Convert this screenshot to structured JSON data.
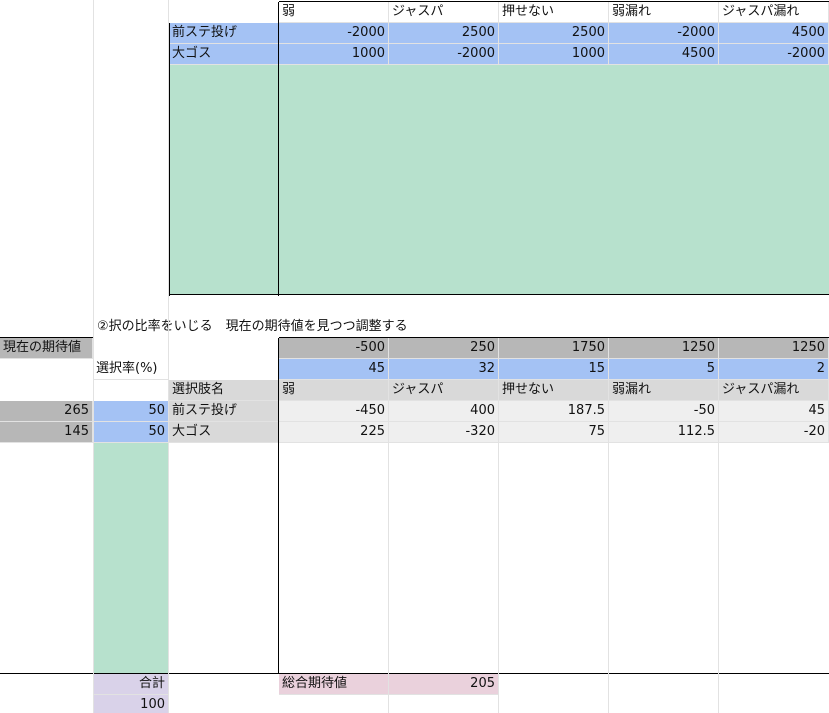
{
  "top_table": {
    "headers": [
      "弱",
      "ジャスパ",
      "押せない",
      "弱漏れ",
      "ジャスパ漏れ"
    ],
    "rows": [
      {
        "label": "前ステ投げ",
        "values": [
          "-2000",
          "2500",
          "2500",
          "-2000",
          "4500"
        ]
      },
      {
        "label": "大ゴス",
        "values": [
          "1000",
          "-2000",
          "1000",
          "4500",
          "-2000"
        ]
      }
    ]
  },
  "instruction": "②択の比率をいじる　現在の期待値を見つつ調整する",
  "bottom": {
    "current_ev_label": "現在の期待値",
    "column_ev": [
      "-500",
      "250",
      "1750",
      "1250",
      "1250"
    ],
    "selection_rate_label": "選択率(%)",
    "selection_rates": [
      "45",
      "32",
      "15",
      "5",
      "2"
    ],
    "option_name_label": "選択肢名",
    "headers": [
      "弱",
      "ジャスパ",
      "押せない",
      "弱漏れ",
      "ジャスパ漏れ"
    ],
    "rows": [
      {
        "ev": "265",
        "ratio": "50",
        "label": "前ステ投げ",
        "values": [
          "-450",
          "400",
          "187.5",
          "-50",
          "45"
        ]
      },
      {
        "ev": "145",
        "ratio": "50",
        "label": "大ゴス",
        "values": [
          "225",
          "-320",
          "75",
          "112.5",
          "-20"
        ]
      }
    ],
    "total_label": "合計",
    "total_value": "100",
    "overall_ev_label": "総合期待値",
    "overall_ev_value": "205"
  },
  "colors": {
    "blue": "#a4c2f4",
    "green": "#b7e1cd",
    "gray": "#b7b7b7",
    "light_gray": "#d9d9d9",
    "pink": "#ead1dc",
    "lavender": "#d9d2e9"
  }
}
